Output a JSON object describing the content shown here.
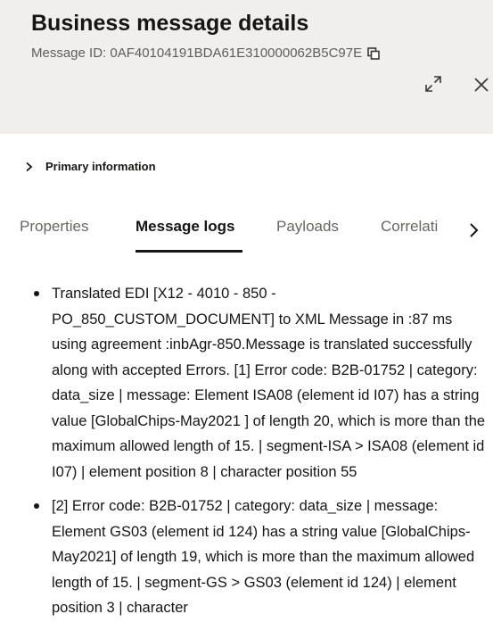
{
  "header": {
    "title": "Business message details",
    "message_id": "Message ID: 0AF40104191BDA61E310000062B5C97E",
    "icons": [
      "copy-icon",
      "expand-icon",
      "close-icon"
    ]
  },
  "primary": {
    "label": "Primary information",
    "icon": "chevron-right-icon"
  },
  "tabs": [
    {
      "label": "Properties",
      "active": false
    },
    {
      "label": "Message logs",
      "active": true
    },
    {
      "label": "Payloads",
      "active": false
    },
    {
      "label": "Correlati",
      "active": false
    }
  ],
  "logs": [
    "Translated EDI [X12 - 4010 - 850 - PO_850_CUSTOM_DOCUMENT] to XML Message in :87 ms using agreement :inbAgr-850.Message is translated successfully along with accepted Errors. [1] Error code: B2B-01752 | category: data_size | message: Element ISA08 (element id I07) has a string value [GlobalChips-May2021 ] of length 20, which is more than the maximum allowed length of 15. | segment-ISA > ISA08 (element id I07) | element position 8 | character position 55",
    "[2] Error code: B2B-01752 | category: data_size | message: Element GS03 (element id 124) has a string value [GlobalChips-May2021] of length 19, which is more than the maximum allowed length of 15. | segment-GS > GS03 (element id 124) | element position 3 | character"
  ],
  "colors": {
    "header_bg": "#f1efed",
    "text": "#161513",
    "muted": "#5f5c59"
  }
}
